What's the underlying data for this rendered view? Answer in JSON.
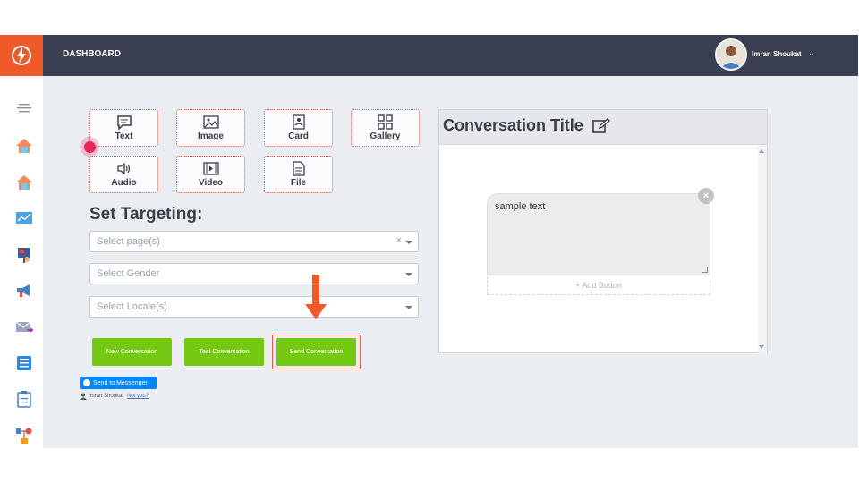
{
  "header": {
    "title": "DASHBOARD",
    "user_name": "Imran Shoukat",
    "caret": "⌄"
  },
  "icons": {
    "logo": "lightning-bolt-icon",
    "sidebar": [
      "menu-icon",
      "home-icon",
      "home-icon",
      "chart-icon",
      "presentation-icon",
      "megaphone-icon",
      "mail-forward-icon",
      "list-icon",
      "clipboard-icon",
      "flow-icon"
    ]
  },
  "message_types": {
    "text": "Text",
    "image": "Image",
    "card": "Card",
    "gallery": "Gallery",
    "audio": "Audio",
    "video": "Video",
    "file": "File"
  },
  "targeting": {
    "title": "Set Targeting:",
    "pages_placeholder": "Select page(s)",
    "pages_clear": "×",
    "gender_placeholder": "Select Gender",
    "locale_placeholder": "Select Locale(s)"
  },
  "actions": {
    "new_conversation": "New Conversation",
    "test_conversation": "Test Conversation",
    "send_conversation": "Send Conversation"
  },
  "messenger": {
    "button_label": "Send to Messenger",
    "user_name": "Imran Shoukat",
    "not_you": "Not you?"
  },
  "conversation": {
    "title": "Conversation Title",
    "sample_text": "sample text",
    "add_button": "+ Add Button",
    "close": "×"
  },
  "colors": {
    "topbar": "#3a3f51",
    "logo_bg": "#f05a28",
    "action_green": "#76c912",
    "tile_border": "#e4573c",
    "messenger_blue": "#0084ff",
    "arrow": "#f05a28"
  }
}
